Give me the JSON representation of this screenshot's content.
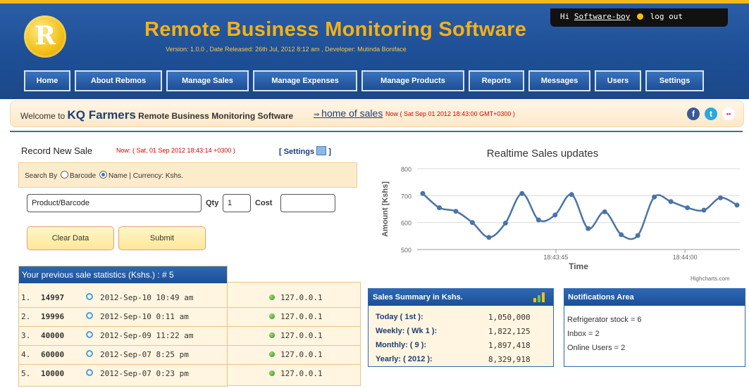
{
  "header": {
    "logo_letter": "R",
    "title": "Remote Business Monitoring Software",
    "version_line": "Version: 1.0.0 , Date Released: 26th Jul, 2012 8:12 am , Developer: Mutinda Boniface",
    "user_greeting": "Hi",
    "username": "Software-boy",
    "logout": "log out"
  },
  "nav": [
    "Home",
    "About Rebmos",
    "Manage Sales",
    "Manage Expenses",
    "Manage Products",
    "Reports",
    "Messages",
    "Users",
    "Settings"
  ],
  "welcome": {
    "prefix": "Welcome to",
    "company": "KQ Farmers",
    "suffix": "Remote Business Monitoring Software",
    "link": "home of sales",
    "now": "Now ( Sat Sep 01 2012 18:43:00 GMT+0300 )"
  },
  "social": [
    "f",
    "t",
    "••"
  ],
  "record": {
    "title": "Record New Sale",
    "now": "Now: ( Sat, 01 Sep 2012 18:43:14 +0300 )",
    "settings": "[ Settings",
    "settings_close": "]",
    "search_by": "Search By",
    "opt_barcode": "Barcode",
    "opt_name": "Name",
    "currency": "| Currency: Kshs.",
    "product_placeholder": "Product/Barcode",
    "qty_label": "Qty",
    "qty_value": "1",
    "cost_label": "Cost",
    "cost_value": "",
    "clear_button": "Clear Data",
    "submit_button": "Submit"
  },
  "stats": {
    "title": "Your previous sale statistics (Kshs.) : # 5",
    "rows": [
      {
        "n": "1.",
        "amount": "14997",
        "date": "2012-Sep-10 10:49 am",
        "ip": "127.0.0.1"
      },
      {
        "n": "2.",
        "amount": "19996",
        "date": "2012-Sep-10 0:11 am",
        "ip": "127.0.0.1"
      },
      {
        "n": "3.",
        "amount": "40000",
        "date": "2012-Sep-09 11:22 am",
        "ip": "127.0.0.1"
      },
      {
        "n": "4.",
        "amount": "60000",
        "date": "2012-Sep-07 8:25 pm",
        "ip": "127.0.0.1"
      },
      {
        "n": "5.",
        "amount": "10000",
        "date": "2012-Sep-07 0:23 pm",
        "ip": "127.0.0.1"
      }
    ]
  },
  "chart_data": {
    "type": "line",
    "title": "Realtime Sales updates",
    "xlabel": "Time",
    "ylabel": "Amount [Kshs]",
    "ylim": [
      500,
      800
    ],
    "yticks": [
      500,
      600,
      700,
      800
    ],
    "xticks": [
      "18:43:45",
      "18:44:00"
    ],
    "credit": "Highcharts.com",
    "series": [
      {
        "values": [
          708,
          655,
          642,
          600,
          545,
          598,
          708,
          610,
          628,
          704,
          578,
          640,
          555,
          552,
          695,
          678,
          655,
          646,
          692,
          665
        ],
        "color": "#4a74a8"
      }
    ],
    "grid": true
  },
  "summary": {
    "title": "Sales Summary in Kshs.",
    "rows": [
      {
        "label": "Today ( 1st ):",
        "value": "1,050,000"
      },
      {
        "label": "Weekly: ( Wk 1 ):",
        "value": "1,822,125"
      },
      {
        "label": "Monthly: ( 9 ):",
        "value": "1,897,418"
      },
      {
        "label": "Yearly: ( 2012 ):",
        "value": "8,329,918"
      }
    ]
  },
  "notifications": {
    "title": "Notifications Area",
    "lines": [
      "Refrigerator stock = 6",
      "Inbox = 2",
      "Online Users = 2"
    ]
  }
}
